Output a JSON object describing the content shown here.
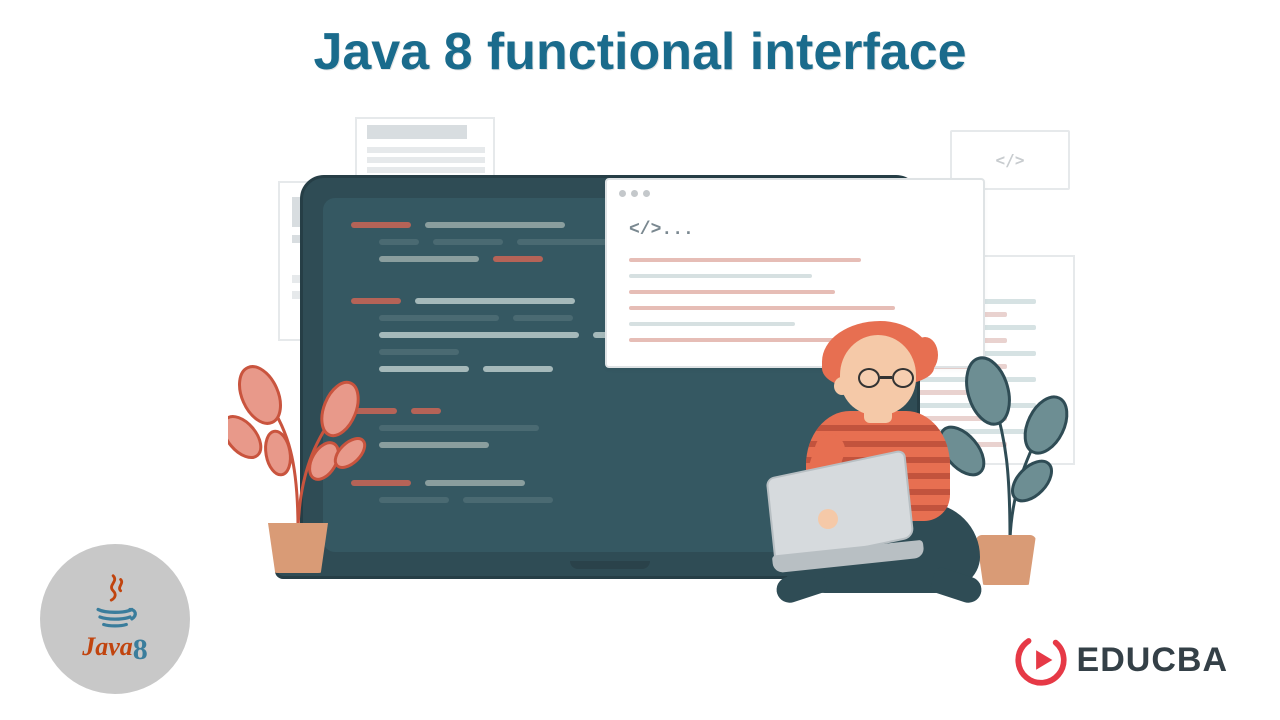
{
  "title": "Java 8 functional interface",
  "bubble": {
    "code_tag": "</>..."
  },
  "java_badge": {
    "label": "Java"
  },
  "brand": {
    "name": "EDUCBA"
  }
}
